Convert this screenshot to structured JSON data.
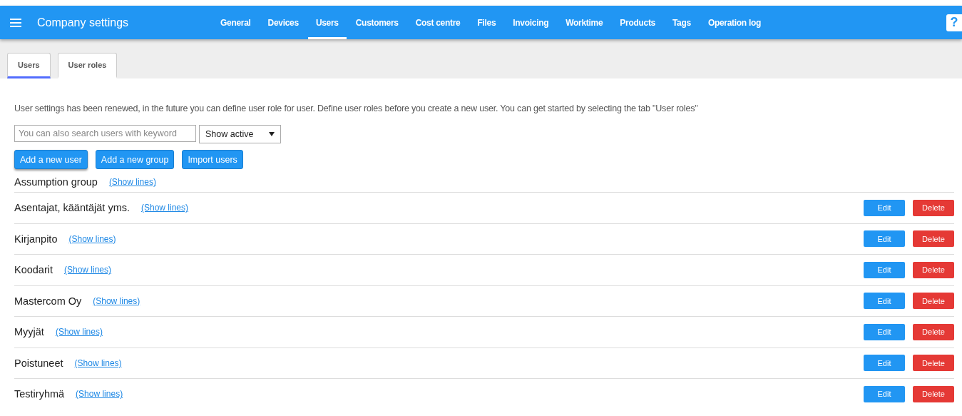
{
  "header": {
    "title": "Company settings",
    "nav": [
      {
        "label": "General",
        "selected": false
      },
      {
        "label": "Devices",
        "selected": false
      },
      {
        "label": "Users",
        "selected": true
      },
      {
        "label": "Customers",
        "selected": false
      },
      {
        "label": "Cost centre",
        "selected": false
      },
      {
        "label": "Files",
        "selected": false
      },
      {
        "label": "Invoicing",
        "selected": false
      },
      {
        "label": "Worktime",
        "selected": false
      },
      {
        "label": "Products",
        "selected": false
      },
      {
        "label": "Tags",
        "selected": false
      },
      {
        "label": "Operation log",
        "selected": false
      }
    ],
    "help": "?"
  },
  "subtabs": [
    {
      "label": "Users",
      "selected": true
    },
    {
      "label": "User roles",
      "selected": false
    }
  ],
  "notice": "User settings has been renewed, in the future you can define user role for user. Define user roles before you create a new user. You can get started by selecting the tab \"User roles\"",
  "search": {
    "placeholder": "You can also search users with keyword"
  },
  "filter": {
    "value": "Show active"
  },
  "buttons": [
    "Add a new user",
    "Add a new group",
    "Import users"
  ],
  "groups": [
    {
      "name": "Assumption group",
      "link": "(Show lines)"
    },
    {
      "name": "Asentajat, kääntäjät yms.",
      "link": "(Show lines)",
      "edit": "Edit",
      "delete": "Delete"
    },
    {
      "name": "Kirjanpito",
      "link": "(Show lines)",
      "edit": "Edit",
      "delete": "Delete"
    },
    {
      "name": "Koodarit",
      "link": "(Show lines)",
      "edit": "Edit",
      "delete": "Delete"
    },
    {
      "name": "Mastercom Oy",
      "link": "(Show lines)",
      "edit": "Edit",
      "delete": "Delete"
    },
    {
      "name": "Myyjät",
      "link": "(Show lines)",
      "edit": "Edit",
      "delete": "Delete"
    },
    {
      "name": "Poistuneet",
      "link": "(Show lines)",
      "edit": "Edit",
      "delete": "Delete"
    },
    {
      "name": "Testiryhmä",
      "link": "(Show lines)",
      "edit": "Edit",
      "delete": "Delete"
    }
  ]
}
